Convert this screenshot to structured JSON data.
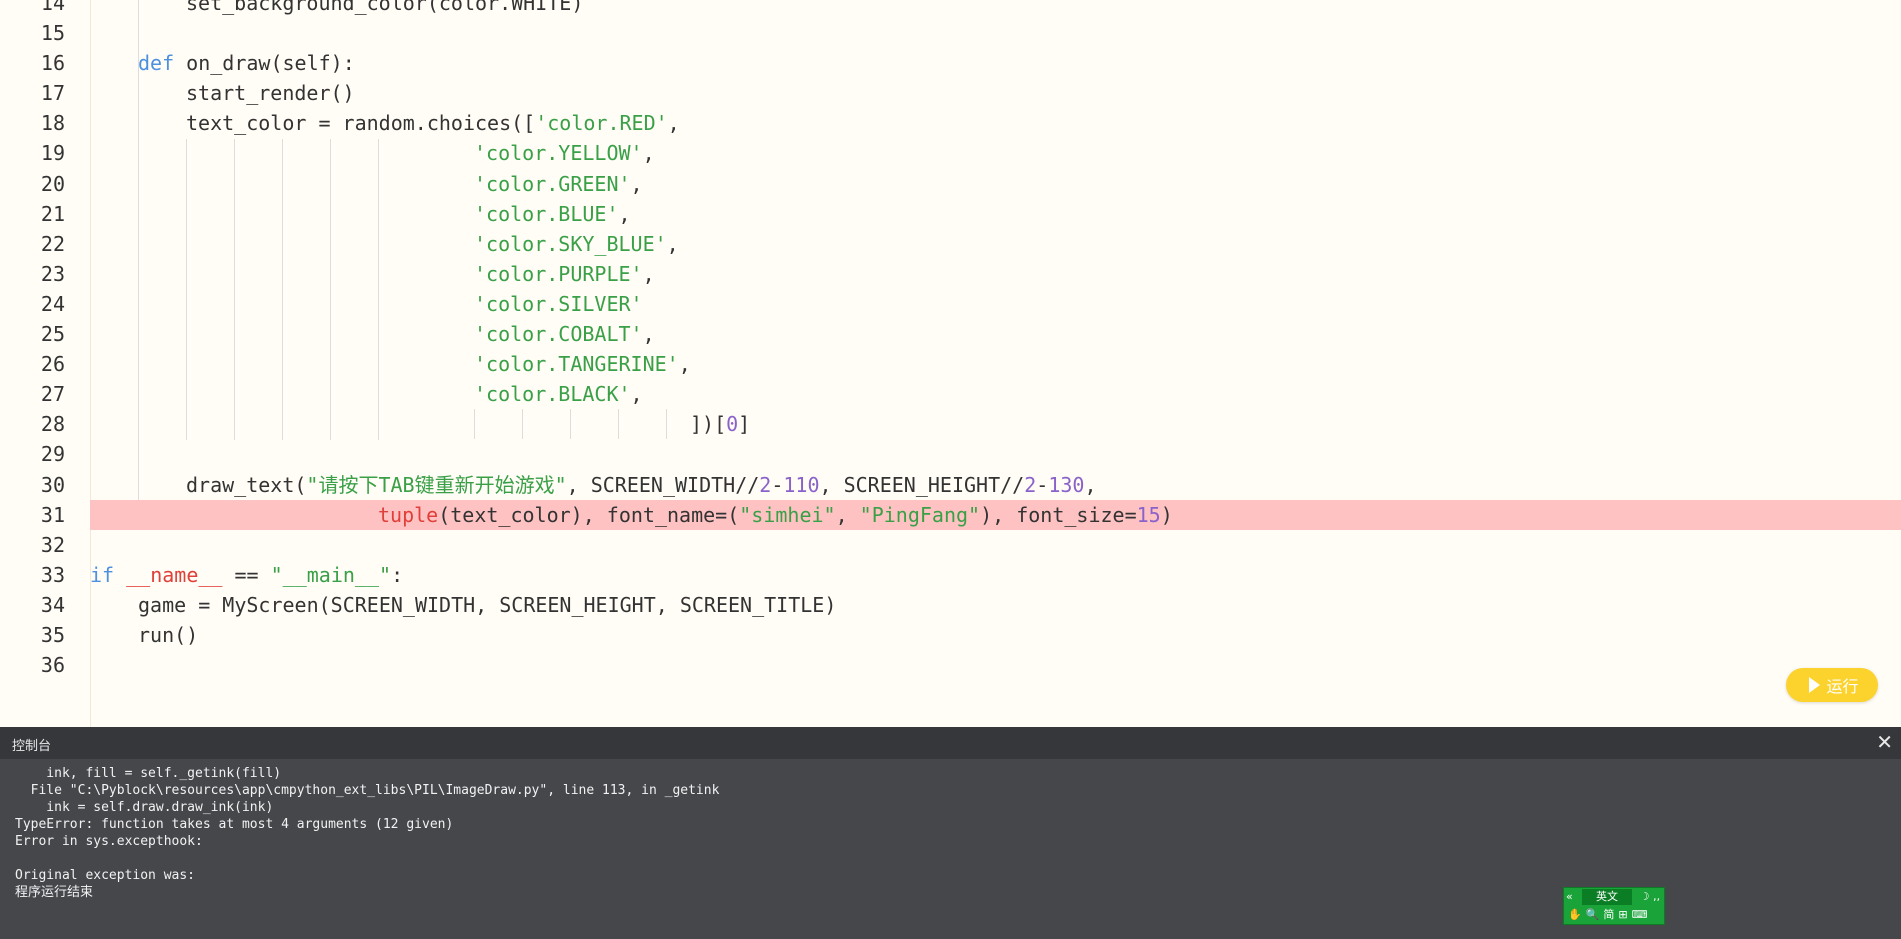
{
  "editor": {
    "lines": [
      {
        "num": "14",
        "indent": 2,
        "tokens": [
          {
            "t": "set_background_color(color.WHITE)",
            "c": ""
          }
        ]
      },
      {
        "num": "15",
        "indent": 0,
        "tokens": []
      },
      {
        "num": "16",
        "indent": 1,
        "tokens": [
          {
            "t": "def",
            "c": "kw"
          },
          {
            "t": " on_draw(self):",
            "c": ""
          }
        ]
      },
      {
        "num": "17",
        "indent": 2,
        "tokens": [
          {
            "t": "start_render()",
            "c": ""
          }
        ]
      },
      {
        "num": "18",
        "indent": 2,
        "tokens": [
          {
            "t": "text_color = random.choices([",
            "c": ""
          },
          {
            "t": "'color.RED'",
            "c": "str"
          },
          {
            "t": ",",
            "c": ""
          }
        ]
      },
      {
        "num": "19",
        "indent": 8,
        "tokens": [
          {
            "t": "'color.YELLOW'",
            "c": "str"
          },
          {
            "t": ",",
            "c": ""
          }
        ]
      },
      {
        "num": "20",
        "indent": 8,
        "tokens": [
          {
            "t": "'color.GREEN'",
            "c": "str"
          },
          {
            "t": ",",
            "c": ""
          }
        ]
      },
      {
        "num": "21",
        "indent": 8,
        "tokens": [
          {
            "t": "'color.BLUE'",
            "c": "str"
          },
          {
            "t": ",",
            "c": ""
          }
        ]
      },
      {
        "num": "22",
        "indent": 8,
        "tokens": [
          {
            "t": "'color.SKY_BLUE'",
            "c": "str"
          },
          {
            "t": ",",
            "c": ""
          }
        ]
      },
      {
        "num": "23",
        "indent": 8,
        "tokens": [
          {
            "t": "'color.PURPLE'",
            "c": "str"
          },
          {
            "t": ",",
            "c": ""
          }
        ]
      },
      {
        "num": "24",
        "indent": 8,
        "tokens": [
          {
            "t": "'color.SILVER'",
            "c": "str"
          }
        ]
      },
      {
        "num": "25",
        "indent": 8,
        "tokens": [
          {
            "t": "'color.COBALT'",
            "c": "str"
          },
          {
            "t": ",",
            "c": ""
          }
        ]
      },
      {
        "num": "26",
        "indent": 8,
        "tokens": [
          {
            "t": "'color.TANGERINE'",
            "c": "str"
          },
          {
            "t": ",",
            "c": ""
          }
        ]
      },
      {
        "num": "27",
        "indent": 8,
        "tokens": [
          {
            "t": "'color.BLACK'",
            "c": "str"
          },
          {
            "t": ",",
            "c": ""
          }
        ]
      },
      {
        "num": "28",
        "indent": 12.5,
        "tokens": [
          {
            "t": "])[",
            "c": ""
          },
          {
            "t": "0",
            "c": "num"
          },
          {
            "t": "]",
            "c": ""
          }
        ]
      },
      {
        "num": "29",
        "indent": 0,
        "tokens": []
      },
      {
        "num": "30",
        "indent": 2,
        "tokens": [
          {
            "t": "draw_text(",
            "c": ""
          },
          {
            "t": "\"请按下TAB键重新开始游戏\"",
            "c": "str"
          },
          {
            "t": ", SCREEN_WIDTH//",
            "c": ""
          },
          {
            "t": "2",
            "c": "num"
          },
          {
            "t": "-",
            "c": ""
          },
          {
            "t": "110",
            "c": "num"
          },
          {
            "t": ", SCREEN_HEIGHT//",
            "c": ""
          },
          {
            "t": "2",
            "c": "num"
          },
          {
            "t": "-",
            "c": ""
          },
          {
            "t": "130",
            "c": "num"
          },
          {
            "t": ",",
            "c": ""
          }
        ]
      },
      {
        "num": "31",
        "indent": 6,
        "error": true,
        "tokens": [
          {
            "t": "tuple",
            "c": "bi"
          },
          {
            "t": "(text_color), font_name=(",
            "c": ""
          },
          {
            "t": "\"simhei\"",
            "c": "str"
          },
          {
            "t": ", ",
            "c": ""
          },
          {
            "t": "\"PingFang\"",
            "c": "str"
          },
          {
            "t": "), font_size=",
            "c": ""
          },
          {
            "t": "15",
            "c": "num"
          },
          {
            "t": ")",
            "c": ""
          }
        ]
      },
      {
        "num": "32",
        "indent": 0,
        "tokens": []
      },
      {
        "num": "33",
        "indent": 0,
        "tokens": [
          {
            "t": "if",
            "c": "kw"
          },
          {
            "t": " ",
            "c": ""
          },
          {
            "t": "__name__",
            "c": "dunder"
          },
          {
            "t": " == ",
            "c": ""
          },
          {
            "t": "\"__main__\"",
            "c": "str"
          },
          {
            "t": ":",
            "c": ""
          }
        ]
      },
      {
        "num": "34",
        "indent": 1,
        "tokens": [
          {
            "t": "game = MyScreen(SCREEN_WIDTH, SCREEN_HEIGHT, SCREEN_TITLE)",
            "c": ""
          }
        ]
      },
      {
        "num": "35",
        "indent": 1,
        "tokens": [
          {
            "t": "run()",
            "c": ""
          }
        ]
      },
      {
        "num": "36",
        "indent": 0,
        "tokens": []
      }
    ]
  },
  "run_button": {
    "label": "运行"
  },
  "console": {
    "title": "控制台",
    "close": "✕",
    "lines": [
      "    ink, fill = self._getink(fill)",
      "  File \"C:\\Pyblock\\resources\\app\\cmpython_ext_libs\\PIL\\ImageDraw.py\", line 113, in _getink",
      "    ink = self.draw.draw_ink(ink)",
      "TypeError: function takes at most 4 arguments (12 given)",
      "Error in sys.excepthook:",
      "",
      "Original exception was:",
      "程序运行结束"
    ]
  },
  "ime": {
    "mode_label": "英文",
    "left_symbol": "«",
    "right_symbol": "☽ ‚‚",
    "tools": "✋🔍简⊞⌨"
  }
}
